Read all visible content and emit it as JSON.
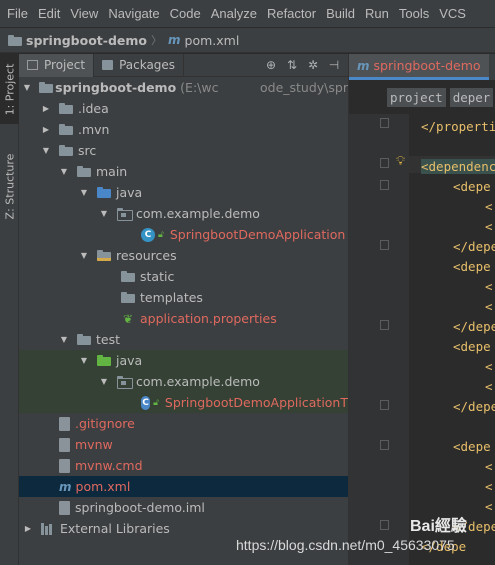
{
  "menu": [
    "File",
    "Edit",
    "View",
    "Navigate",
    "Code",
    "Analyze",
    "Refactor",
    "Build",
    "Run",
    "Tools",
    "VCS"
  ],
  "breadcrumb": {
    "project": "springboot-demo",
    "file": "pom.xml"
  },
  "side_tabs": {
    "project": "1: Project",
    "structure": "Z: Structure"
  },
  "panel_tabs": {
    "project": "Project",
    "packages": "Packages"
  },
  "toolbar_icons": [
    "crosshair-icon",
    "collapse-all-icon",
    "gear-icon",
    "hide-icon"
  ],
  "tree": {
    "root_name": "springboot-demo",
    "root_path": "(E:\\wc",
    "root_path_tail": "ode_study\\spr",
    "idea": ".idea",
    "mvn": ".mvn",
    "src": "src",
    "main": "main",
    "java": "java",
    "main_pkg": "com.example.demo",
    "main_class": "SpringbootDemoApplication",
    "resources": "resources",
    "static": "static",
    "templates": "templates",
    "app_props": "application.properties",
    "test": "test",
    "test_java": "java",
    "test_pkg": "com.example.demo",
    "test_class": "SpringbootDemoApplicationT",
    "gitignore": ".gitignore",
    "mvnw": "mvnw",
    "mvnw_cmd": "mvnw.cmd",
    "pom": "pom.xml",
    "iml": "springboot-demo.iml",
    "ext_libs": "External Libraries"
  },
  "editor": {
    "tab_label": "springboot-demo",
    "breadcrumb": [
      "project",
      "deper"
    ],
    "lines": [
      "</propertie",
      "<dependenc",
      "<depe",
      "<",
      "<",
      "</depe",
      "<depe",
      "<",
      "<",
      "</depe",
      "<depe",
      "<",
      "<",
      "</depe",
      "<depe",
      "<",
      "<",
      "<",
      "</depe",
      "</depe"
    ]
  },
  "watermark": {
    "url": "https://blog.csdn.net/m0_45633075",
    "brand": "Bai經驗"
  },
  "colors": {
    "accent": "#4a88c7",
    "error_text": "#e0695f",
    "selection": "#0d293e"
  }
}
